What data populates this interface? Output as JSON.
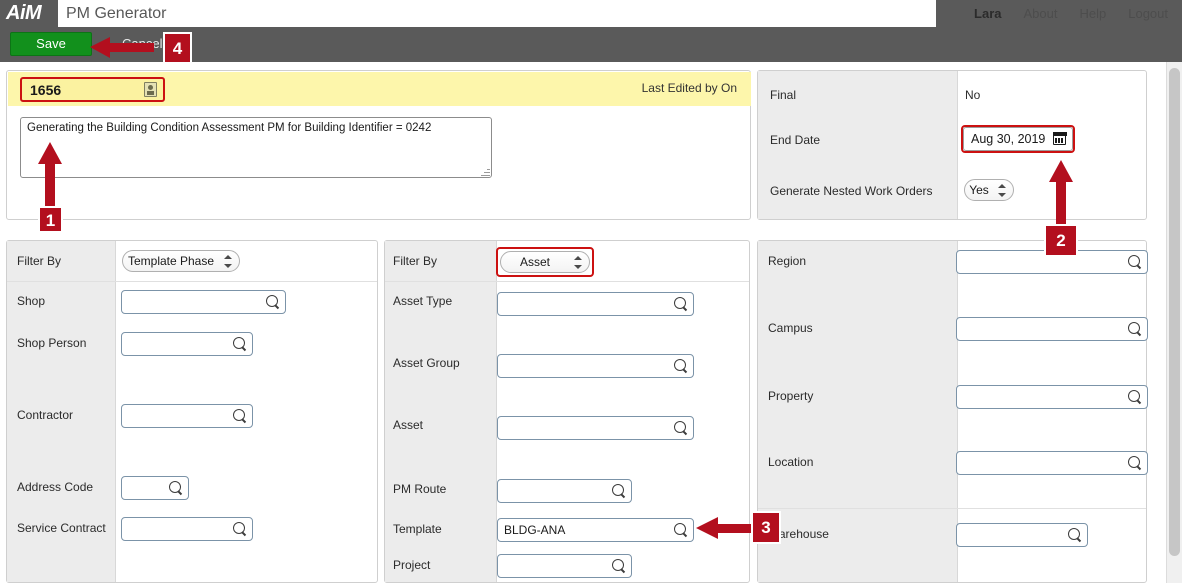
{
  "app": {
    "brand": "AiM",
    "tab_title": "PM Generator"
  },
  "nav": {
    "user": "Lara",
    "about": "About",
    "help": "Help",
    "logout": "Logout"
  },
  "toolbar": {
    "save_label": "Save",
    "cancel_label": "Cancel"
  },
  "record_header": {
    "id_value": "1656",
    "id_icon": "document-lookup-icon",
    "last_edited_label": "Last Edited by  On",
    "description": "Generating the Building Condition Assessment PM for Building Identifier = 0242"
  },
  "header_right": {
    "final_label": "Final",
    "final_value": "No",
    "end_date_label": "End Date",
    "end_date_value": "Aug 30, 2019",
    "nested_label": "Generate Nested Work Orders",
    "nested_value": "Yes"
  },
  "left_panel": {
    "filter_by_label": "Filter By",
    "filter_by_value": "Template Phase",
    "fields": [
      {
        "label": "Shop",
        "value": ""
      },
      {
        "label": "Shop Person",
        "value": ""
      },
      {
        "label": "Contractor",
        "value": ""
      },
      {
        "label": "Address Code",
        "value": ""
      },
      {
        "label": "Service Contract",
        "value": ""
      }
    ]
  },
  "mid_panel": {
    "filter_by_label": "Filter By",
    "filter_by_value": "Asset",
    "fields": [
      {
        "label": "Asset Type",
        "value": ""
      },
      {
        "label": "Asset Group",
        "value": ""
      },
      {
        "label": "Asset",
        "value": ""
      },
      {
        "label": "PM Route",
        "value": ""
      },
      {
        "label": "Template",
        "value": "BLDG-ANA"
      },
      {
        "label": "Project",
        "value": ""
      }
    ]
  },
  "right_panel": {
    "fields": [
      {
        "label": "Region",
        "value": ""
      },
      {
        "label": "Campus",
        "value": ""
      },
      {
        "label": "Property",
        "value": ""
      },
      {
        "label": "Location",
        "value": ""
      },
      {
        "label": "Warehouse",
        "value": ""
      }
    ]
  },
  "annotations": {
    "badge1": "1",
    "badge2": "2",
    "badge3": "3",
    "badge4": "4"
  },
  "colors": {
    "accent_red": "#b30f1e",
    "highlight_red": "#cc1111",
    "save_green": "#12901c",
    "header_grey": "#5a5a5a",
    "yellow_band": "#fdf6ab"
  }
}
